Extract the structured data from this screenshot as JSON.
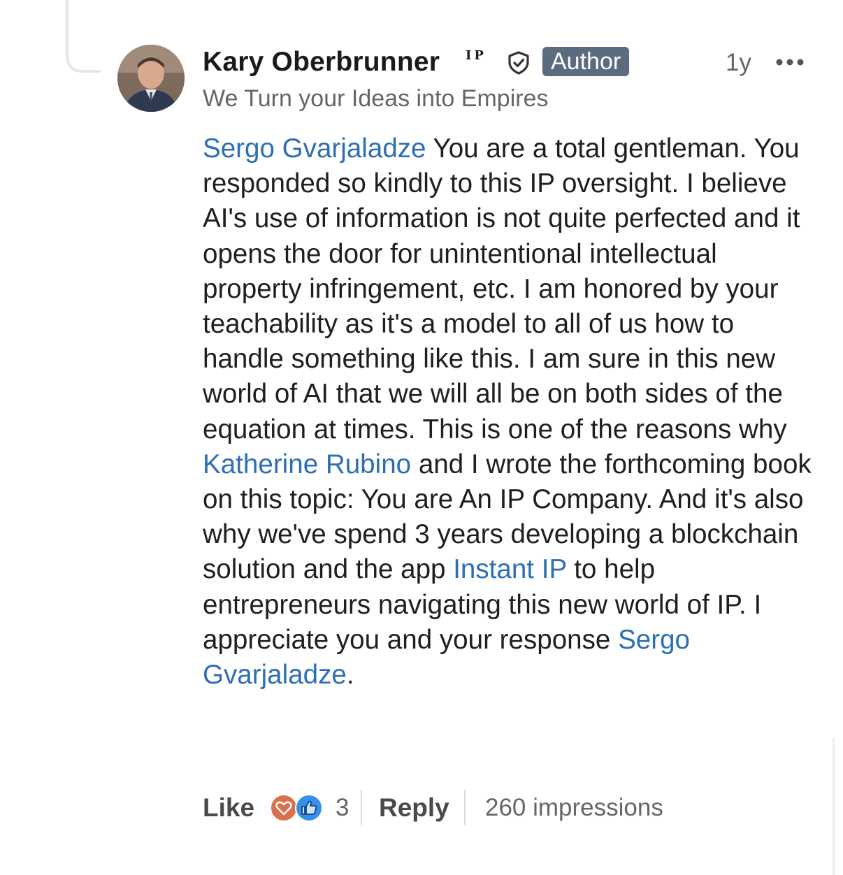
{
  "comment": {
    "author": {
      "name": "Kary Oberbrunner",
      "ip_mark": "IP",
      "badge": "Author",
      "headline": "We Turn your Ideas into Empires",
      "avatar_icon": "person-photo-icon"
    },
    "time": "1y",
    "more_icon": "ellipsis-icon",
    "body": [
      {
        "type": "mention",
        "text": "Sergo Gvarjaladze"
      },
      {
        "type": "text",
        "text": " You are a total gentleman. You responded so kindly to this IP oversight. I believe AI's use of information is not quite perfected and it opens the door for unintentional intellectual property infringement, etc. I am honored by your teachability as it's a model to all of us how to handle something like this. I am sure in this new world of AI that we will all be on both sides of the equation at times. This is one of the reasons why "
      },
      {
        "type": "mention",
        "text": "Katherine Rubino"
      },
      {
        "type": "text",
        "text": " and I wrote the forthcoming book on this topic: You are An IP Company. And it's also why we've spend 3 years developing a blockchain solution and the app "
      },
      {
        "type": "mention",
        "text": "Instant IP"
      },
      {
        "type": "text",
        "text": " to help entrepreneurs navigating this new world of IP. I appreciate you and your response "
      },
      {
        "type": "mention",
        "text": "Sergo Gvarjaladze"
      },
      {
        "type": "text",
        "text": "."
      }
    ],
    "actions": {
      "like_label": "Like",
      "reaction_count": "3",
      "reply_label": "Reply",
      "impressions": "260 impressions"
    },
    "colors": {
      "mention": "#2d6fb4",
      "badge_bg": "#5b6b80",
      "love": "#d9704e",
      "like": "#378fe9"
    }
  }
}
